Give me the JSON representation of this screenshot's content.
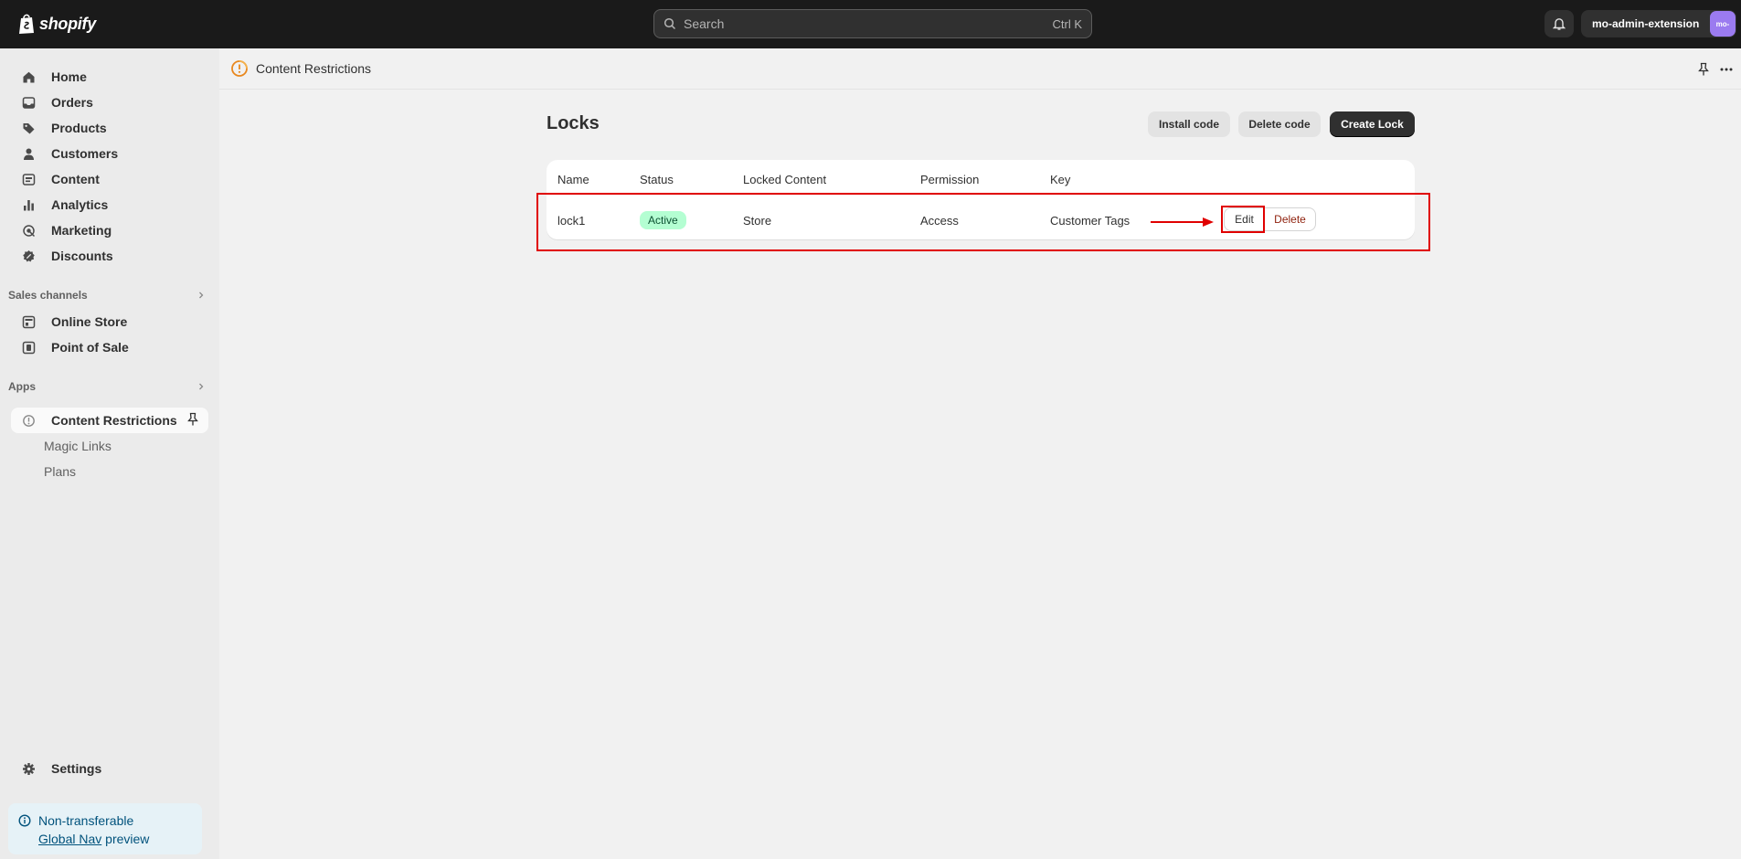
{
  "topbar": {
    "logo_text": "shopify",
    "search_placeholder": "Search",
    "search_shortcut": "Ctrl K",
    "store_name": "mo-admin-extension",
    "avatar_text": "mo-",
    "avatar_color": "#9b7bf0"
  },
  "sidebar": {
    "items": [
      {
        "label": "Home",
        "icon": "home-icon"
      },
      {
        "label": "Orders",
        "icon": "inbox-icon"
      },
      {
        "label": "Products",
        "icon": "tag-icon"
      },
      {
        "label": "Customers",
        "icon": "person-icon"
      },
      {
        "label": "Content",
        "icon": "image-icon"
      },
      {
        "label": "Analytics",
        "icon": "bar-chart-icon"
      },
      {
        "label": "Marketing",
        "icon": "target-icon"
      },
      {
        "label": "Discounts",
        "icon": "discount-icon"
      }
    ],
    "sales_channels_label": "Sales channels",
    "channels": [
      {
        "label": "Online Store",
        "icon": "store-icon"
      },
      {
        "label": "Point of Sale",
        "icon": "pos-icon"
      }
    ],
    "apps_label": "Apps",
    "app_selected": "Content Restrictions",
    "app_subitems": [
      "Magic Links",
      "Plans"
    ],
    "settings_label": "Settings",
    "notice_line1": "Non-transferable",
    "notice_link": "Global Nav",
    "notice_suffix": "preview"
  },
  "app_header": {
    "title": "Content Restrictions"
  },
  "page": {
    "title": "Locks",
    "buttons": {
      "install": "Install code",
      "delete_code": "Delete code",
      "create": "Create Lock"
    }
  },
  "table": {
    "headers": [
      "Name",
      "Status",
      "Locked Content",
      "Permission",
      "Key"
    ],
    "rows": [
      {
        "name": "lock1",
        "status": "Active",
        "locked_content": "Store",
        "permission": "Access",
        "key": "Customer Tags",
        "edit_label": "Edit",
        "delete_label": "Delete"
      }
    ]
  },
  "colors": {
    "topbar": "#1a1a1a",
    "sidebar": "#ebebeb",
    "background": "#f1f1f1",
    "badge_active_bg": "#b4fed2",
    "badge_active_text": "#0c5132",
    "annotation": "#e00000",
    "app_icon": "#e8871e"
  }
}
